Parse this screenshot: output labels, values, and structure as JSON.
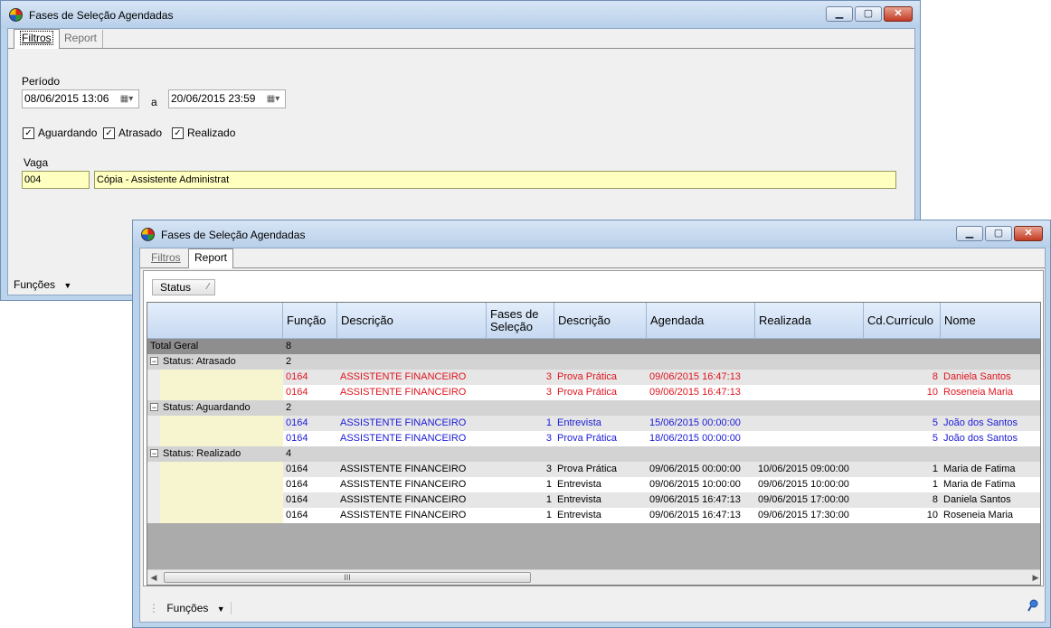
{
  "window_back": {
    "title": "Fases de Seleção Agendadas",
    "tabs": [
      {
        "label": "Filtros"
      },
      {
        "label": "Report"
      }
    ],
    "periodo_label": "Período",
    "date_from": "08/06/2015 13:06",
    "date_sep": "a",
    "date_to": "20/06/2015 23:59",
    "checkboxes": [
      {
        "label": "Aguardando",
        "checked": true
      },
      {
        "label": "Atrasado",
        "checked": true
      },
      {
        "label": "Realizado",
        "checked": true
      }
    ],
    "vaga_label": "Vaga",
    "vaga_code": "004",
    "vaga_desc": "Cópia - Assistente Administrat",
    "funcoes_label": "Funções"
  },
  "window_front": {
    "title": "Fases de Seleção Agendadas",
    "tabs": [
      {
        "label": "Filtros"
      },
      {
        "label": "Report"
      }
    ],
    "group_button_label": "Status",
    "columns": [
      "Função",
      "Descrição",
      "Fases de Seleção",
      "Descrição",
      "Agendada",
      "Realizada",
      "Cd.Currículo",
      "Nome"
    ],
    "total_label": "Total Geral",
    "total_count": "8",
    "groups": [
      {
        "label": "Status: Atrasado",
        "count": "2",
        "color": "#e0141e",
        "rows": [
          {
            "funcao": "0164",
            "descricao": "ASSISTENTE FINANCEIRO",
            "fase": "3",
            "fase_desc": "Prova Prática",
            "agendada": "09/06/2015 16:47:13",
            "realizada": "",
            "cd": "8",
            "nome": "Daniela Santos"
          },
          {
            "funcao": "0164",
            "descricao": "ASSISTENTE FINANCEIRO",
            "fase": "3",
            "fase_desc": "Prova Prática",
            "agendada": "09/06/2015 16:47:13",
            "realizada": "",
            "cd": "10",
            "nome": "Roseneia Maria"
          }
        ]
      },
      {
        "label": "Status: Aguardando",
        "count": "2",
        "color": "#1a1ad8",
        "rows": [
          {
            "funcao": "0164",
            "descricao": "ASSISTENTE FINANCEIRO",
            "fase": "1",
            "fase_desc": "Entrevista",
            "agendada": "15/06/2015 00:00:00",
            "realizada": "",
            "cd": "5",
            "nome": "João dos Santos"
          },
          {
            "funcao": "0164",
            "descricao": "ASSISTENTE FINANCEIRO",
            "fase": "3",
            "fase_desc": "Prova Prática",
            "agendada": "18/06/2015 00:00:00",
            "realizada": "",
            "cd": "5",
            "nome": "João dos Santos"
          }
        ]
      },
      {
        "label": "Status: Realizado",
        "count": "4",
        "color": "#000000",
        "rows": [
          {
            "funcao": "0164",
            "descricao": "ASSISTENTE FINANCEIRO",
            "fase": "3",
            "fase_desc": "Prova Prática",
            "agendada": "09/06/2015 00:00:00",
            "realizada": "10/06/2015 09:00:00",
            "cd": "1",
            "nome": "Maria de Fatima"
          },
          {
            "funcao": "0164",
            "descricao": "ASSISTENTE FINANCEIRO",
            "fase": "1",
            "fase_desc": "Entrevista",
            "agendada": "09/06/2015 10:00:00",
            "realizada": "09/06/2015 10:00:00",
            "cd": "1",
            "nome": "Maria de Fatima"
          },
          {
            "funcao": "0164",
            "descricao": "ASSISTENTE FINANCEIRO",
            "fase": "1",
            "fase_desc": "Entrevista",
            "agendada": "09/06/2015 16:47:13",
            "realizada": "09/06/2015 17:00:00",
            "cd": "8",
            "nome": "Daniela Santos"
          },
          {
            "funcao": "0164",
            "descricao": "ASSISTENTE FINANCEIRO",
            "fase": "1",
            "fase_desc": "Entrevista",
            "agendada": "09/06/2015 16:47:13",
            "realizada": "09/06/2015 17:30:00",
            "cd": "10",
            "nome": "Roseneia Maria"
          }
        ]
      }
    ],
    "scroll_thumb_glyph": "III",
    "funcoes_label": "Funções"
  }
}
